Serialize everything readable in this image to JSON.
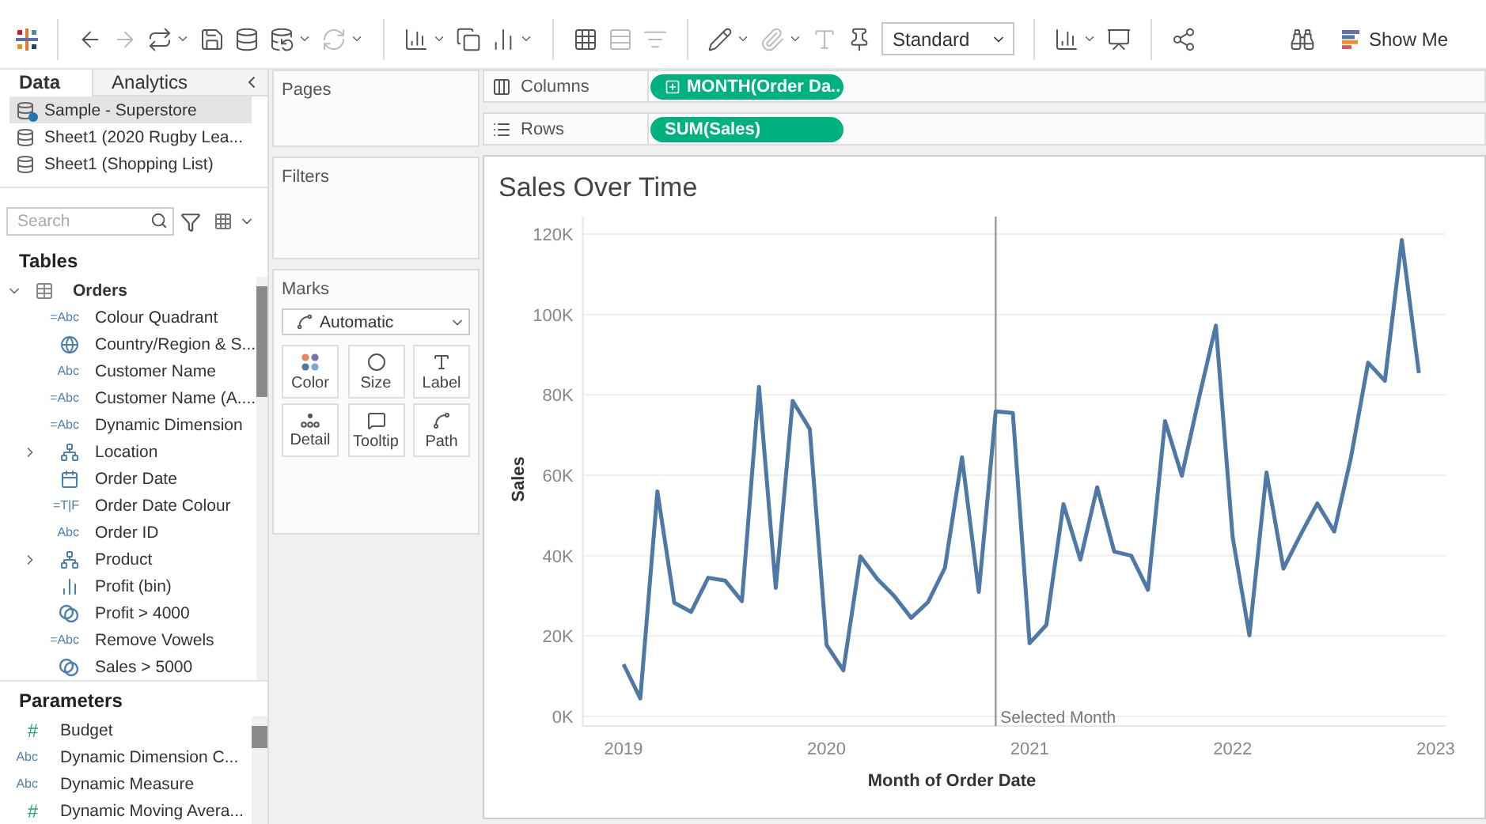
{
  "toolbar": {
    "view_size": "Standard",
    "show_me": "Show Me"
  },
  "data_pane": {
    "tabs": [
      {
        "label": "Data",
        "selected": true
      },
      {
        "label": "Analytics",
        "selected": false
      }
    ],
    "data_sources": [
      {
        "name": "Sample - Superstore",
        "selected": true
      },
      {
        "name": "Sheet1 (2020 Rugby Lea...",
        "selected": false
      },
      {
        "name": "Sheet1 (Shopping List)",
        "selected": false
      }
    ],
    "search": {
      "placeholder": "Search"
    },
    "tables_heading": "Tables",
    "table": {
      "name": "Orders",
      "expanded": true,
      "fields": [
        {
          "name": "Colour Quadrant",
          "kind": "glyph",
          "glyph": "=Abc",
          "expander": false
        },
        {
          "name": "Country/Region & S...",
          "kind": "geo",
          "expander": false
        },
        {
          "name": "Customer Name",
          "kind": "glyph",
          "glyph": "Abc",
          "expander": false
        },
        {
          "name": "Customer Name (A....",
          "kind": "glyph",
          "glyph": "=Abc",
          "expander": false
        },
        {
          "name": "Dynamic Dimension",
          "kind": "glyph",
          "glyph": "=Abc",
          "expander": false
        },
        {
          "name": "Location",
          "kind": "hierarchy",
          "expander": true
        },
        {
          "name": "Order Date",
          "kind": "date",
          "expander": false
        },
        {
          "name": "Order Date Colour",
          "kind": "glyph",
          "glyph": "=T|F",
          "expander": false
        },
        {
          "name": "Order ID",
          "kind": "glyph",
          "glyph": "Abc",
          "expander": false
        },
        {
          "name": "Product",
          "kind": "hierarchy",
          "expander": true
        },
        {
          "name": "Profit (bin)",
          "kind": "bin",
          "expander": false
        },
        {
          "name": "Profit > 4000",
          "kind": "set",
          "expander": false
        },
        {
          "name": "Remove Vowels",
          "kind": "glyph",
          "glyph": "=Abc",
          "expander": false
        },
        {
          "name": "Sales > 5000",
          "kind": "set",
          "expander": false
        }
      ]
    },
    "parameters_heading": "Parameters",
    "parameters": [
      {
        "name": "Budget",
        "glyph": "#",
        "kind": "number"
      },
      {
        "name": "Dynamic Dimension C...",
        "glyph": "Abc",
        "kind": "string"
      },
      {
        "name": "Dynamic Measure",
        "glyph": "Abc",
        "kind": "string"
      },
      {
        "name": "Dynamic Moving Avera...",
        "glyph": "#",
        "kind": "number"
      }
    ]
  },
  "cards": {
    "pages": "Pages",
    "filters": "Filters",
    "marks": {
      "title": "Marks",
      "mark_type": "Automatic",
      "buttons": [
        {
          "label": "Color",
          "kind": "color"
        },
        {
          "label": "Size",
          "kind": "size"
        },
        {
          "label": "Label",
          "kind": "label"
        },
        {
          "label": "Detail",
          "kind": "detail"
        },
        {
          "label": "Tooltip",
          "kind": "tooltip"
        },
        {
          "label": "Path",
          "kind": "path"
        }
      ]
    }
  },
  "shelves": [
    {
      "label": "Columns",
      "kind": "columns",
      "pill": "MONTH(Order Da..",
      "expandable": true
    },
    {
      "label": "Rows",
      "kind": "rows",
      "pill": "SUM(Sales)",
      "expandable": false
    }
  ],
  "view": {
    "title": "Sales Over Time",
    "chart_data": {
      "type": "line",
      "xlabel": "Month of Order Date",
      "ylabel": "Sales",
      "x": [
        2019,
        2019.083,
        2019.167,
        2019.25,
        2019.333,
        2019.417,
        2019.5,
        2019.583,
        2019.667,
        2019.75,
        2019.833,
        2019.917,
        2020,
        2020.083,
        2020.167,
        2020.25,
        2020.333,
        2020.417,
        2020.5,
        2020.583,
        2020.667,
        2020.75,
        2020.833,
        2020.917,
        2021,
        2021.083,
        2021.167,
        2021.25,
        2021.333,
        2021.417,
        2021.5,
        2021.583,
        2021.667,
        2021.75,
        2021.833,
        2021.917,
        2022,
        2022.083,
        2022.167,
        2022.25,
        2022.333,
        2022.417,
        2022.5,
        2022.583,
        2022.667,
        2022.75,
        2022.833,
        2022.917
      ],
      "grid": true,
      "series": [
        {
          "color": "#4e79a7",
          "values": [
            13,
            4.5,
            56,
            28.3,
            26,
            34.5,
            33.8,
            28.7,
            82,
            32,
            78.5,
            71.5,
            17.8,
            11.5,
            39.8,
            34.2,
            30,
            24.5,
            28.5,
            37,
            64.5,
            31,
            75.9,
            75.5,
            18.2,
            22.8,
            52.8,
            39,
            57,
            41,
            40,
            31.5,
            73.5,
            59.9,
            79,
            97.2,
            44.6,
            20.2,
            60.7,
            36.8,
            45,
            53,
            46,
            64.5,
            88,
            83.5,
            118.5,
            85.4
          ]
        }
      ],
      "xlim": [
        2018.8,
        2023.05
      ],
      "ylim": [
        0,
        120
      ],
      "xticks": [
        2019,
        2020,
        2021,
        2022,
        2023
      ],
      "yticks": [
        {
          "value": 0,
          "label": "0K"
        },
        {
          "value": 20,
          "label": "20K"
        },
        {
          "value": 40,
          "label": "40K"
        },
        {
          "value": 60,
          "label": "60K"
        },
        {
          "value": 80,
          "label": "80K"
        },
        {
          "value": 100,
          "label": "100K"
        },
        {
          "value": 120,
          "label": "120K"
        }
      ],
      "ref_lines": [
        {
          "axis": "x",
          "value": 2020.833,
          "label": "Selected Month",
          "color": "#999999"
        }
      ]
    }
  }
}
